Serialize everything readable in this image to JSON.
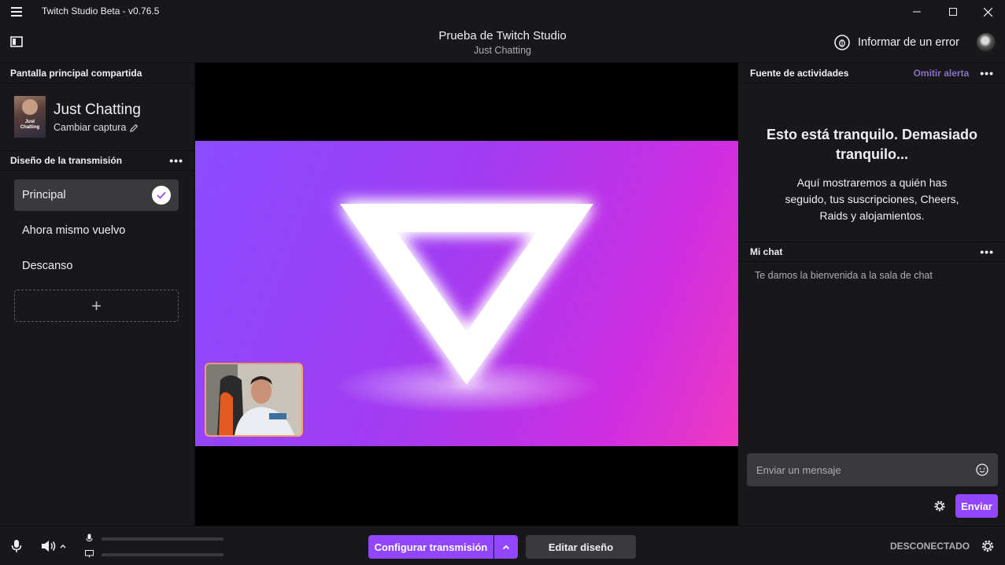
{
  "app": {
    "title": "Twitch Studio Beta - v0.76.5"
  },
  "header": {
    "stream_title": "Prueba de Twitch Studio",
    "category": "Just Chatting",
    "report_label": "Informar de un error"
  },
  "left": {
    "shared_label": "Pantalla principal compartida",
    "game_name": "Just Chatting",
    "game_box_text": "Just Chatting",
    "change_capture": "Cambiar captura",
    "layout_header": "Diseño de la transmisión",
    "layouts": [
      {
        "label": "Principal",
        "active": true
      },
      {
        "label": "Ahora mismo vuelvo",
        "active": false
      },
      {
        "label": "Descanso",
        "active": false
      }
    ],
    "add_symbol": "+"
  },
  "right": {
    "activity_header": "Fuente de actividades",
    "omit_alert": "Omitir alerta",
    "quiet_title": "Esto está tranquilo. Demasiado tranquilo...",
    "quiet_desc": "Aquí mostraremos a quién has seguido, tus suscripciones, Cheers, Raids y alojamientos.",
    "chat_header": "Mi chat",
    "welcome": "Te damos la bienvenida a la sala de chat",
    "input_placeholder": "Enviar un mensaje",
    "send_label": "Enviar"
  },
  "bottom": {
    "configure_label": "Configurar transmisión",
    "edit_layout_label": "Editar diseño",
    "status": "DESCONECTADO"
  },
  "colors": {
    "accent": "#9147ff",
    "panel": "#18181b",
    "active_item": "#3a3a3d"
  }
}
